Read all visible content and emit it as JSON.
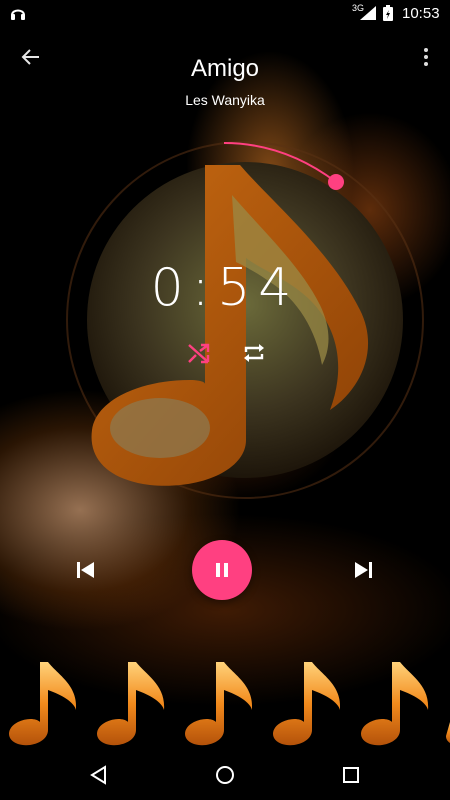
{
  "status_bar": {
    "network_type": "3G",
    "time": "10:53",
    "icons": [
      "headset-icon",
      "signal-icon",
      "battery-icon"
    ]
  },
  "track": {
    "title": "Amigo",
    "artist": "Les Wanyika",
    "elapsed": "0:54",
    "progress_fraction": 0.12
  },
  "controls": {
    "shuffle_icon": "shuffle-icon",
    "repeat_icon": "repeat-icon",
    "previous_icon": "skip-previous-icon",
    "play_pause_icon": "pause-icon",
    "next_icon": "skip-next-icon"
  },
  "navigation": {
    "back_icon": "arrow-back-icon",
    "menu_icon": "more-vert-icon",
    "system_nav": [
      "back-triangle-icon",
      "home-circle-icon",
      "recents-square-icon"
    ]
  },
  "colors": {
    "accent": "#ff4081",
    "art_orange": "#c8620e",
    "background": "#000000"
  }
}
